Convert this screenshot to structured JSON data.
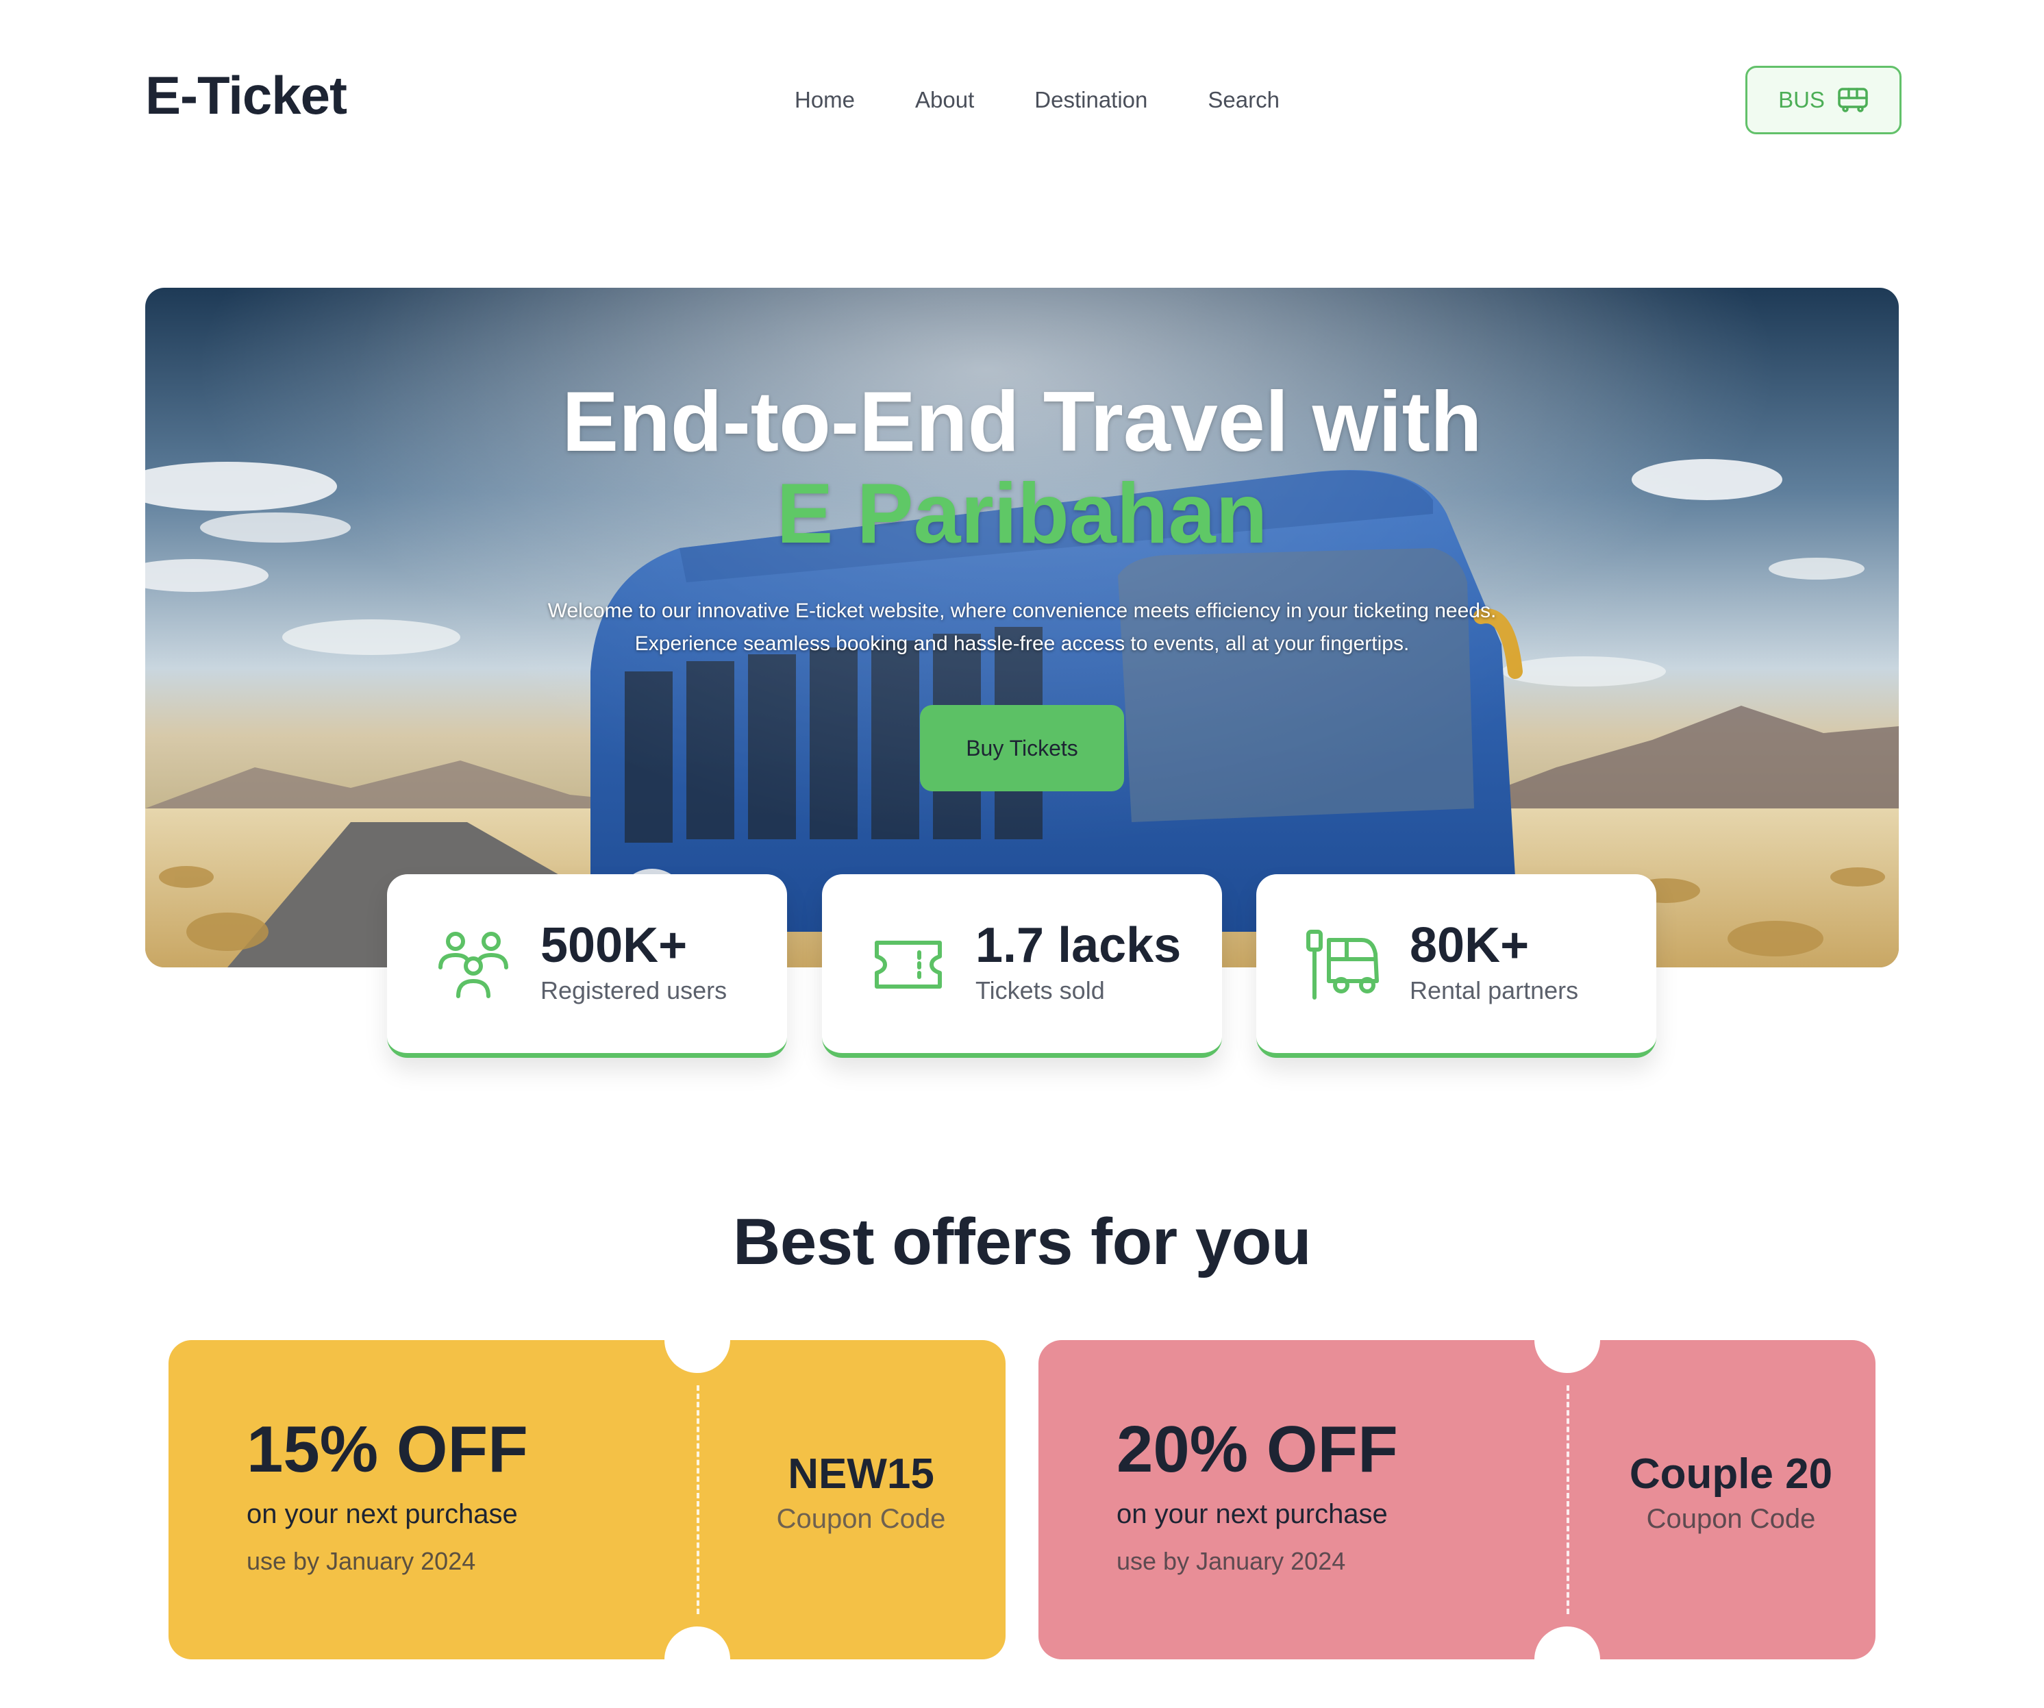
{
  "brand": {
    "name": "E-Ticket"
  },
  "nav": {
    "items": [
      "Home",
      "About",
      "Destination",
      "Search"
    ]
  },
  "header": {
    "cta_label": "BUS",
    "cta_icon": "bus-icon"
  },
  "hero": {
    "title_line1": "End-to-End Travel with",
    "title_line2": "E Paribahan",
    "desc_line1": "Welcome to our innovative E-ticket website, where convenience meets efficiency in your ticketing needs.",
    "desc_line2": "Experience seamless booking and hassle-free access to events, all at your fingertips.",
    "button_label": "Buy Tickets"
  },
  "stats": [
    {
      "value": "500K+",
      "label": "Registered users",
      "icon": "users-icon"
    },
    {
      "value": "1.7 lacks",
      "label": "Tickets sold",
      "icon": "ticket-icon"
    },
    {
      "value": "80K+",
      "label": "Rental partners",
      "icon": "bus-stop-icon"
    }
  ],
  "offers": {
    "title": "Best offers for you",
    "items": [
      {
        "discount": "15% OFF",
        "subtitle": "on your next purchase",
        "validity": "use by January 2024",
        "code": "NEW15",
        "code_label": "Coupon Code",
        "color": "#f4c146"
      },
      {
        "discount": "20% OFF",
        "subtitle": "on your next purchase",
        "validity": "use by January 2024",
        "code": "Couple 20",
        "code_label": "Coupon Code",
        "color": "#e88e97"
      }
    ]
  },
  "colors": {
    "accent": "#5cc165",
    "text": "#1d2433",
    "offer_yellow": "#f4c146",
    "offer_pink": "#e88e97"
  }
}
